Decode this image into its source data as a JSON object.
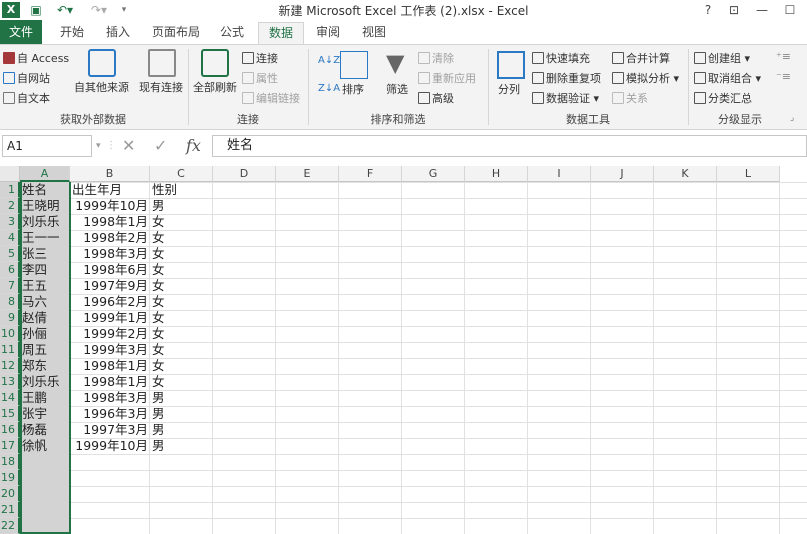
{
  "titlebar": {
    "title": "新建 Microsoft Excel 工作表 (2).xlsx - Excel",
    "help": "?",
    "restore_ribbon": "⊡",
    "minimize": "—",
    "maximize": "☐"
  },
  "tabs": [
    {
      "label": "文件"
    },
    {
      "label": "开始"
    },
    {
      "label": "插入"
    },
    {
      "label": "页面布局"
    },
    {
      "label": "公式"
    },
    {
      "label": "数据"
    },
    {
      "label": "审阅"
    },
    {
      "label": "视图"
    }
  ],
  "ribbon": {
    "external": {
      "from_access": "自 Access",
      "from_web": "自网站",
      "from_text": "自文本",
      "from_other": "自其他来源",
      "existing": "现有连接",
      "label": "获取外部数据"
    },
    "connections": {
      "refresh_all": "全部刷新",
      "connections": "连接",
      "properties": "属性",
      "edit_links": "编辑链接",
      "label": "连接"
    },
    "sort_filter": {
      "sort": "排序",
      "filter": "筛选",
      "clear": "清除",
      "reapply": "重新应用",
      "advanced": "高级",
      "label": "排序和筛选"
    },
    "data_tools": {
      "split": "分列",
      "flash_fill": "快速填充",
      "remove_dup": "删除重复项",
      "validation": "数据验证",
      "consolidate": "合并计算",
      "what_if": "模拟分析",
      "relations": "关系",
      "label": "数据工具"
    },
    "outline": {
      "group": "创建组",
      "ungroup": "取消组合",
      "subtotal": "分类汇总",
      "label": "分级显示"
    }
  },
  "formula_bar": {
    "name_box": "A1",
    "fx": "fx",
    "cancel": "✕",
    "enter": "✓",
    "content": "姓名"
  },
  "grid": {
    "columns": [
      "A",
      "B",
      "C",
      "D",
      "E",
      "F",
      "G",
      "H",
      "I",
      "J",
      "K",
      "L"
    ],
    "rows": [
      "1",
      "2",
      "3",
      "4",
      "5",
      "6",
      "7",
      "8",
      "9",
      "10",
      "11",
      "12",
      "13",
      "14",
      "15",
      "16",
      "17",
      "18",
      "19",
      "20",
      "21",
      "22"
    ],
    "data": [
      [
        "姓名",
        "出生年月",
        "性别"
      ],
      [
        "王晓明",
        "1999年10月",
        "男"
      ],
      [
        "刘乐乐",
        "1998年1月",
        "女"
      ],
      [
        "王一一",
        "1998年2月",
        "女"
      ],
      [
        "张三",
        "1998年3月",
        "女"
      ],
      [
        "李四",
        "1998年6月",
        "女"
      ],
      [
        "王五",
        "1997年9月",
        "女"
      ],
      [
        "马六",
        "1996年2月",
        "女"
      ],
      [
        "赵倩",
        "1999年1月",
        "女"
      ],
      [
        "孙俪",
        "1999年2月",
        "女"
      ],
      [
        "周五",
        "1999年3月",
        "女"
      ],
      [
        "郑东",
        "1998年1月",
        "女"
      ],
      [
        "刘乐乐",
        "1998年1月",
        "女"
      ],
      [
        "王鹏",
        "1998年3月",
        "男"
      ],
      [
        "张宇",
        "1996年3月",
        "男"
      ],
      [
        "杨磊",
        "1997年3月",
        "男"
      ],
      [
        "徐帆",
        "1999年10月",
        "男"
      ]
    ]
  },
  "colors": {
    "accent": "#217346",
    "ribbon_bg": "#f3f3f3",
    "grid_line": "#e1e1e1",
    "selected_col": "#d3d3d3"
  }
}
